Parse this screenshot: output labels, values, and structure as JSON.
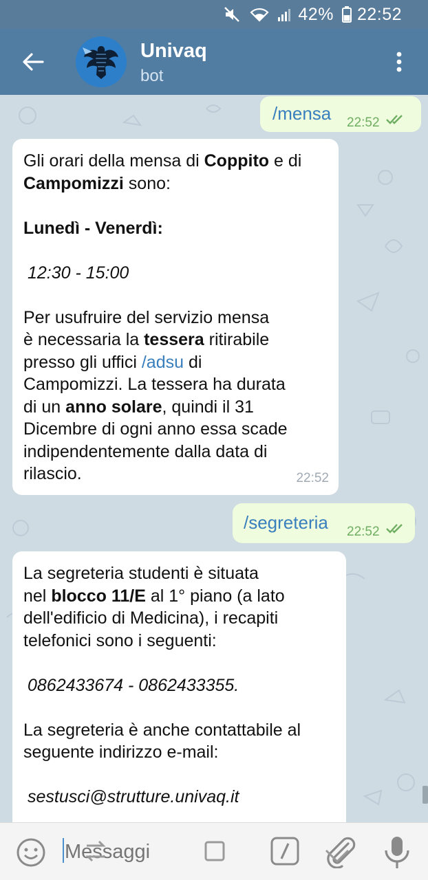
{
  "status_bar": {
    "battery_percent": "42%",
    "time": "22:52",
    "icons": [
      "mute-icon",
      "wifi-icon",
      "signal-icon",
      "battery-icon"
    ],
    "color": "#5a7c9b"
  },
  "app_bar": {
    "title": "Univaq",
    "subtitle": "bot",
    "back_icon": "arrow-left-icon",
    "menu_icon": "more-vertical-icon",
    "color": "#527da3"
  },
  "messages": [
    {
      "direction": "out",
      "text": "/mensa",
      "time": "22:52",
      "status": "read"
    },
    {
      "direction": "in",
      "time": "22:52",
      "l1_a": "Gli orari della mensa di ",
      "l1_b": "Coppito",
      "l1_c": " e di",
      "l2_a": "Campomizzi",
      "l2_b": " sono:",
      "l3": "Lunedì - Venerdì:",
      "l4": "12:30 - 15:00",
      "l5": "Per usufruire del servizio mensa",
      "l6_a": "è necessaria la ",
      "l6_b": "tessera",
      "l6_c": " ritirabile",
      "l7_a": "presso gli uffici ",
      "l7_b": "/adsu",
      "l7_c": " di",
      "l8": "Campomizzi. La tessera ha durata",
      "l9_a": "di un ",
      "l9_b": "anno solare",
      "l9_c": ", quindi il 31",
      "l10": "Dicembre di ogni anno essa scade",
      "l11": "indipendentemente dalla data di",
      "l12": "rilascio."
    },
    {
      "direction": "out",
      "text": "/segreteria",
      "time": "22:52",
      "status": "read"
    },
    {
      "direction": "in",
      "l1": "La segreteria studenti  è situata",
      "l2_a": "nel ",
      "l2_b": "blocco 11/E",
      "l2_c": " al 1° piano (a lato",
      "l3": "dell'edificio di Medicina), i recapiti",
      "l4": "telefonici sono i seguenti:",
      "l5": "0862433674 - 0862433355.",
      "l6": "La segreteria è anche contattabile al",
      "l7": "seguente indirizzo e-mail:",
      "l8": "sestusci@strutture.univaq.it"
    }
  ],
  "input_bar": {
    "placeholder": "Messaggi",
    "emoji_icon": "emoji-icon",
    "attach_icon": "paperclip-icon",
    "mic_icon": "microphone-icon",
    "command_icon": "slash-command-icon"
  },
  "colors": {
    "chat_background": "#cfdbe3",
    "outgoing_bubble": "#effdde",
    "incoming_bubble": "#ffffff",
    "link": "#3a7fbd",
    "outgoing_time": "#6fae62"
  }
}
